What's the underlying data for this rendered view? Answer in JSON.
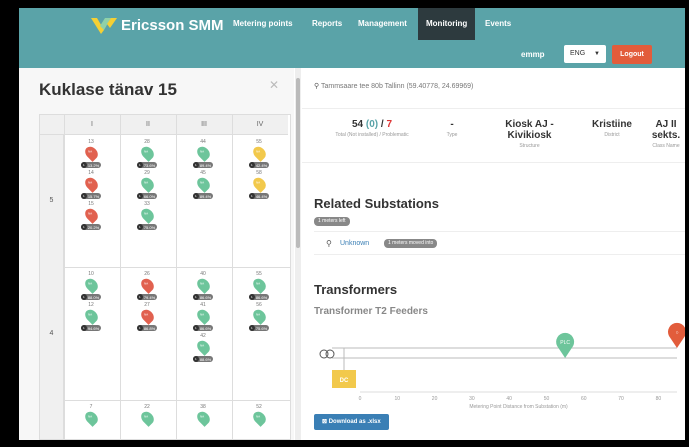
{
  "header": {
    "brand": "Ericsson SMM",
    "nav": [
      {
        "label": "Metering points",
        "active": false
      },
      {
        "label": "Reports",
        "active": false
      },
      {
        "label": "Management",
        "active": false
      },
      {
        "label": "Monitoring",
        "active": true
      },
      {
        "label": "Events",
        "active": false
      }
    ],
    "user": "emmp",
    "language": "ENG",
    "logout": "Logout"
  },
  "left_panel": {
    "title": "Kuklase tänav 15",
    "columns": [
      "I",
      "II",
      "III",
      "IV"
    ],
    "rows": [
      {
        "label": "5",
        "cells": [
          [
            {
              "num": "13",
              "color": "red",
              "badge": "13.2%"
            },
            {
              "num": "14",
              "color": "red",
              "badge": "15.7%"
            },
            {
              "num": "15",
              "color": "red",
              "badge": "20.2%"
            }
          ],
          [
            {
              "num": "28",
              "color": "green",
              "badge": "73.6%"
            },
            {
              "num": "29",
              "color": "green",
              "badge": "66.0%"
            },
            {
              "num": "33",
              "color": "green",
              "badge": "75.0%"
            }
          ],
          [
            {
              "num": "44",
              "color": "green",
              "badge": "89.4%"
            },
            {
              "num": "45",
              "color": "green",
              "badge": "89.4%"
            }
          ],
          [
            {
              "num": "55",
              "color": "yellow",
              "badge": "42.4%"
            },
            {
              "num": "58",
              "color": "yellow",
              "badge": "46.4%"
            }
          ]
        ]
      },
      {
        "label": "4",
        "cells": [
          [
            {
              "num": "10",
              "color": "green",
              "badge": "88.0%"
            },
            {
              "num": "12",
              "color": "green",
              "badge": "94.6%"
            }
          ],
          [
            {
              "num": "26",
              "color": "red",
              "badge": "79.4%"
            },
            {
              "num": "27",
              "color": "red",
              "badge": "86.8%"
            }
          ],
          [
            {
              "num": "40",
              "color": "green",
              "badge": "86.6%"
            },
            {
              "num": "41",
              "color": "green",
              "badge": "86.6%"
            },
            {
              "num": "42",
              "color": "green",
              "badge": "88.6%"
            }
          ],
          [
            {
              "num": "55",
              "color": "green",
              "badge": "86.6%"
            },
            {
              "num": "56",
              "color": "green",
              "badge": "75.6%"
            }
          ]
        ]
      },
      {
        "label": "",
        "cells": [
          [
            {
              "num": "7",
              "color": "green",
              "badge": ""
            }
          ],
          [
            {
              "num": "22",
              "color": "green",
              "badge": ""
            }
          ],
          [
            {
              "num": "38",
              "color": "green",
              "badge": ""
            }
          ],
          [
            {
              "num": "52",
              "color": "green",
              "badge": ""
            }
          ]
        ]
      }
    ],
    "pin_label": "NA"
  },
  "right_panel": {
    "address": "Tammsaare tee 80b Tallinn (59.40778, 24.69969)",
    "stats": [
      {
        "value_a": "54",
        "value_b": "(0)",
        "value_c": "7",
        "label": "Total (Not installed) / Problematic"
      },
      {
        "value": "-",
        "label": "Type"
      },
      {
        "value": "Kiosk AJ - Kivikiosk",
        "label": "Structure"
      },
      {
        "value": "Kristiine",
        "label": "District"
      },
      {
        "value": "AJ II sekts.",
        "label": "Class Name"
      }
    ],
    "related_title": "Related Substations",
    "meters_left": "1 meters left",
    "unknown": "Unknown",
    "moved_into": "1 meters moved into",
    "transformers_title": "Transformers",
    "transformer_sub": "Transformer T2 Feeders",
    "download": "Download as .xlsx"
  },
  "chart_data": {
    "type": "scatter",
    "title": "",
    "xlabel": "Metering Point Distance from Substation (m)",
    "ylabel": "",
    "xlim": [
      0,
      85
    ],
    "ticks": [
      0,
      10,
      20,
      30,
      40,
      50,
      60,
      70,
      80
    ],
    "points": [
      {
        "x": 55,
        "label": "PLC",
        "color": "#6dc59b",
        "line": 1
      },
      {
        "x": 85,
        "label": "",
        "color": "#e25c3b",
        "line": 0
      }
    ],
    "box_label": "DC",
    "colors": {
      "green": "#6dc59b",
      "red": "#e1614f",
      "yellow": "#f2c94c"
    }
  }
}
